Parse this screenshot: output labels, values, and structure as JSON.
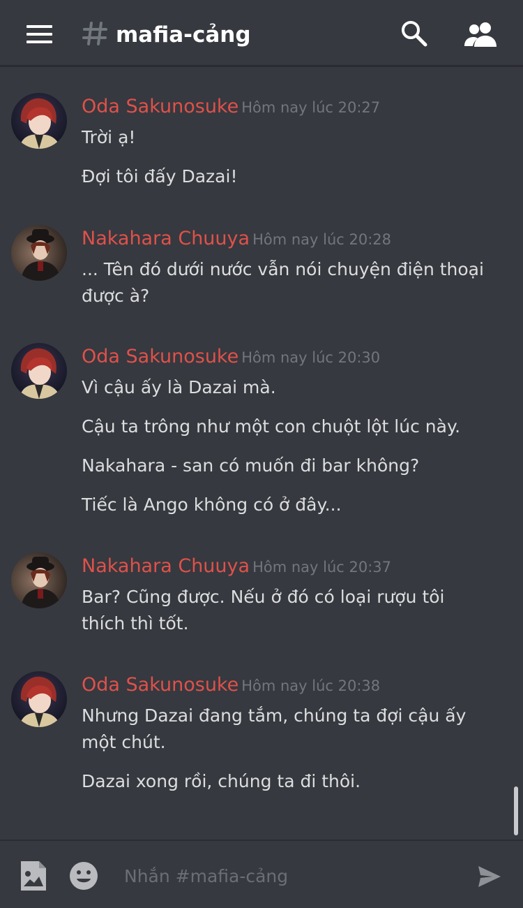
{
  "header": {
    "channel_name": "mafia-cảng"
  },
  "messages": [
    {
      "author": "Oda Sakunosuke",
      "timestamp": "Hôm nay lúc 20:27",
      "avatar": "oda-avatar",
      "lines": [
        "Trời ạ!",
        "Đợi tôi đấy Dazai!"
      ]
    },
    {
      "author": "Nakahara Chuuya",
      "timestamp": "Hôm nay lúc 20:28",
      "avatar": "chuuya-avatar",
      "lines": [
        "... Tên đó dưới nước vẫn nói chuyện điện thoại",
        "được à?"
      ]
    },
    {
      "author": "Oda Sakunosuke",
      "timestamp": "Hôm nay lúc 20:30",
      "avatar": "oda-avatar",
      "lines": [
        "Vì cậu ấy là Dazai mà.",
        "Cậu ta trông như một con chuột lột lúc này.",
        "Nakahara - san có muốn đi bar không?",
        "Tiếc là Ango không có ở đây..."
      ]
    },
    {
      "author": "Nakahara Chuuya",
      "timestamp": "Hôm nay lúc 20:37",
      "avatar": "chuuya-avatar",
      "lines": [
        "Bar? Cũng được. Nếu ở đó có loại rượu tôi",
        "thích thì tốt."
      ]
    },
    {
      "author": "Oda Sakunosuke",
      "timestamp": "Hôm nay lúc 20:38",
      "avatar": "oda-avatar",
      "lines": [
        "Nhưng Dazai đang tắm, chúng ta đợi cậu ấy",
        "một chút.",
        "Dazai xong rồi, chúng ta đi thôi."
      ]
    }
  ],
  "composer": {
    "placeholder": "Nhắn #mafia-cảng"
  },
  "colors": {
    "background": "#36393f",
    "author": "#e0514a",
    "timestamp": "#72767d",
    "text": "#dcddde"
  },
  "icons": {
    "menu": "hamburger-menu-icon",
    "channel": "hash-icon",
    "search": "search-icon",
    "members": "members-icon",
    "attach": "image-icon",
    "emoji": "emoji-icon",
    "send": "send-icon"
  }
}
